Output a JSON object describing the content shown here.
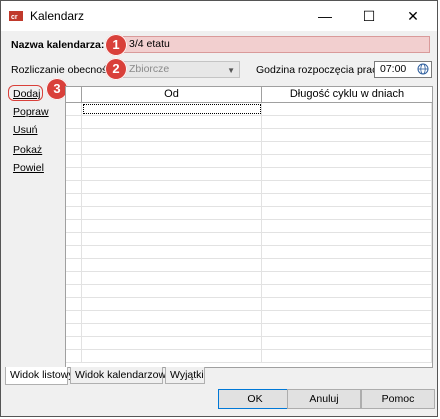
{
  "window": {
    "title": "Kalendarz",
    "controls": {
      "minimize": "—",
      "maximize": "☐",
      "close": "✕"
    }
  },
  "form": {
    "name_label": "Nazwa kalendarza:",
    "name_value": "3/4 etatu",
    "settlement_label": "Rozliczanie obecności",
    "settlement_value": "Zbiorcze",
    "start_time_label": "Godzina rozpoczęcia pracy:",
    "start_time_value": "07:00"
  },
  "annotations": {
    "badge1": "1",
    "badge2": "2",
    "badge3": "3",
    "color": "#d9403a"
  },
  "actions": [
    "Dodaj",
    "Popraw",
    "Usuń",
    "Pokaż",
    "Powiel"
  ],
  "table": {
    "columns": [
      "",
      "Od",
      "Długość cyklu w dniach"
    ],
    "rows": []
  },
  "tabs": [
    "Widok listowy",
    "Widok kalendarzowy",
    "Wyjątki"
  ],
  "buttons": {
    "ok": "OK",
    "cancel": "Anuluj",
    "help": "Pomoc"
  }
}
